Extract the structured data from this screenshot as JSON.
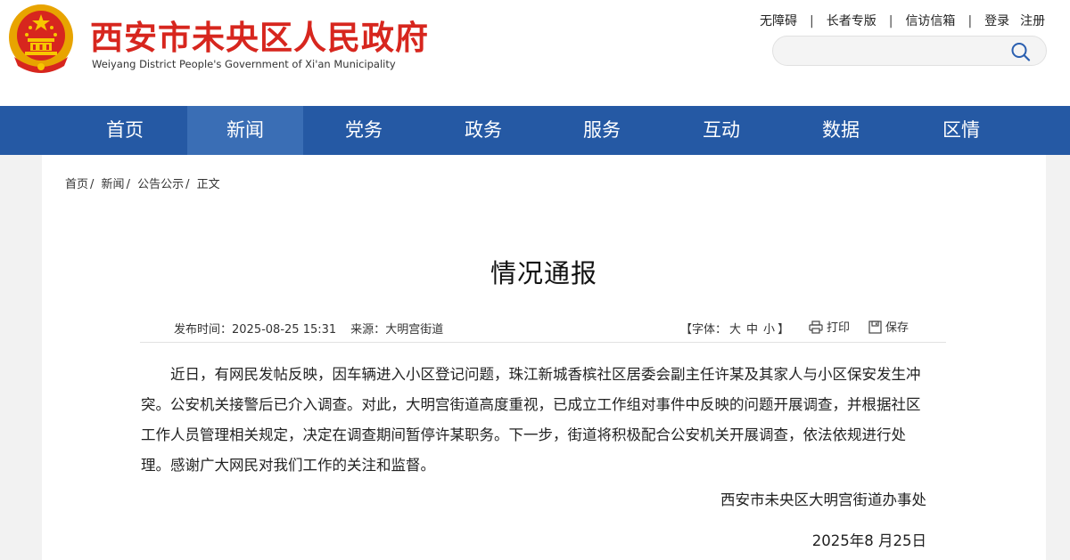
{
  "header": {
    "site_title": "西安市未央区人民政府",
    "site_subtitle": "Weiyang District People's Government of  Xi'an  Municipality",
    "top_links": [
      "无障碍",
      "长者专版",
      "信访信箱"
    ],
    "login": "登录",
    "register": "注册",
    "search": {
      "placeholder": "",
      "value": ""
    }
  },
  "nav": {
    "items": [
      "首页",
      "新闻",
      "党务",
      "政务",
      "服务",
      "互动",
      "数据",
      "区情"
    ],
    "active": "新闻",
    "color": "#2559a4",
    "active_color": "#3a6eb5"
  },
  "breadcrumb": [
    "首页",
    "新闻",
    "公告公示",
    "正文"
  ],
  "article": {
    "title": "情况通报",
    "publish_label": "发布时间：",
    "publish_time": "2025-08-25 15:31",
    "source_label": "来源：",
    "source": "大明宫街道",
    "font_label": "【字体：",
    "font_sizes": [
      "大",
      "中",
      "小"
    ],
    "font_close": "】",
    "print": "打印",
    "save": "保存",
    "body": "近日，有网民发帖反映，因车辆进入小区登记问题，珠江新城香槟社区居委会副主任许某及其家人与小区保安发生冲突。公安机关接警后已介入调查。对此，大明宫街道高度重视，已成立工作组对事件中反映的问题开展调查，并根据社区工作人员管理相关规定，决定在调查期间暂停许某职务。下一步，街道将积极配合公安机关开展调查，依法依规进行处理。感谢广大网民对我们工作的关注和监督。",
    "signature": "西安市未央区大明宫街道办事处",
    "date": "2025年8 月25日"
  },
  "colors": {
    "brand_red": "#d7261e",
    "page_bg": "#f2f2f2"
  }
}
